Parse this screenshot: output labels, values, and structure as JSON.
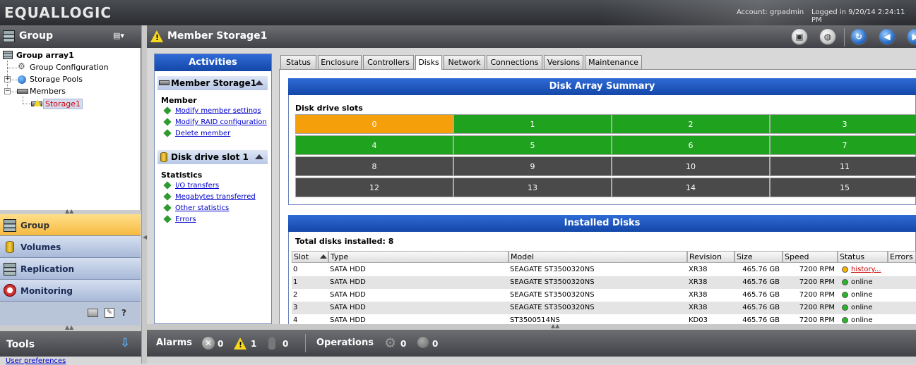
{
  "brand": "EQUALLOGIC",
  "header": {
    "account": "Account: grpadmin",
    "logged_in": "Logged in 9/20/14 2:24:11 PM"
  },
  "left_panel": {
    "title": "Group",
    "tree": [
      {
        "label": "Group array1"
      },
      {
        "label": "Group Configuration"
      },
      {
        "label": "Storage Pools"
      },
      {
        "label": "Members"
      },
      {
        "label": "Storage1"
      }
    ]
  },
  "nav": [
    {
      "label": "Group",
      "icon": "server-icon"
    },
    {
      "label": "Volumes",
      "icon": "cylinder-icon"
    },
    {
      "label": "Replication",
      "icon": "replication-icon"
    },
    {
      "label": "Monitoring",
      "icon": "gauge-icon"
    }
  ],
  "tools": {
    "title": "Tools",
    "link": "User preferences"
  },
  "main": {
    "title": "Member Storage1"
  },
  "activities": {
    "title": "Activities",
    "section1": {
      "title": "Member Storage1",
      "subtitle": "Member",
      "links": [
        "Modify member settings",
        "Modify RAID configuration",
        "Delete member"
      ]
    },
    "section2": {
      "title": "Disk drive slot 1",
      "subtitle": "Statistics",
      "links": [
        "I/O transfers",
        "Megabytes transferred",
        "Other statistics",
        "Errors"
      ]
    }
  },
  "tabs": [
    "Status",
    "Enclosure",
    "Controllers",
    "Disks",
    "Network",
    "Connections",
    "Versions",
    "Maintenance"
  ],
  "active_tab": "Disks",
  "summary": {
    "title": "Disk Array Summary",
    "slots_label": "Disk drive slots",
    "slots": [
      {
        "n": "0",
        "state": "warning"
      },
      {
        "n": "1",
        "state": "online"
      },
      {
        "n": "2",
        "state": "online"
      },
      {
        "n": "3",
        "state": "online"
      },
      {
        "n": "4",
        "state": "online"
      },
      {
        "n": "5",
        "state": "online"
      },
      {
        "n": "6",
        "state": "online"
      },
      {
        "n": "7",
        "state": "online"
      },
      {
        "n": "8",
        "state": "empty"
      },
      {
        "n": "9",
        "state": "empty"
      },
      {
        "n": "10",
        "state": "empty"
      },
      {
        "n": "11",
        "state": "empty"
      },
      {
        "n": "12",
        "state": "empty"
      },
      {
        "n": "13",
        "state": "empty"
      },
      {
        "n": "14",
        "state": "empty"
      },
      {
        "n": "15",
        "state": "empty"
      }
    ],
    "colors": {
      "warning": "#f5a00a",
      "online": "#1fa31f",
      "empty": "#4a4a4a"
    }
  },
  "installed": {
    "title": "Installed Disks",
    "total": "Total disks installed: 8",
    "columns": [
      "Slot",
      "Type",
      "Model",
      "Revision",
      "Size",
      "Speed",
      "Status",
      "Errors"
    ],
    "rows": [
      {
        "slot": "0",
        "type": "SATA HDD",
        "model": "SEAGATE ST3500320NS",
        "revision": "XR38",
        "size": "465.76 GB",
        "speed": "7200 RPM",
        "status": "history...",
        "state": "warning"
      },
      {
        "slot": "1",
        "type": "SATA HDD",
        "model": "SEAGATE ST3500320NS",
        "revision": "XR38",
        "size": "465.76 GB",
        "speed": "7200 RPM",
        "status": "online",
        "state": "online"
      },
      {
        "slot": "2",
        "type": "SATA HDD",
        "model": "SEAGATE ST3500320NS",
        "revision": "XR38",
        "size": "465.76 GB",
        "speed": "7200 RPM",
        "status": "online",
        "state": "online"
      },
      {
        "slot": "3",
        "type": "SATA HDD",
        "model": "SEAGATE ST3500320NS",
        "revision": "XR38",
        "size": "465.76 GB",
        "speed": "7200 RPM",
        "status": "online",
        "state": "online"
      },
      {
        "slot": "4",
        "type": "SATA HDD",
        "model": "ST3500514NS",
        "revision": "KD03",
        "size": "465.76 GB",
        "speed": "7200 RPM",
        "status": "online",
        "state": "online"
      }
    ]
  },
  "bottom": {
    "alarms_label": "Alarms",
    "alarm_critical": "0",
    "alarm_warning": "1",
    "alarm_info": "0",
    "operations_label": "Operations",
    "ops_active": "0",
    "ops_failed": "0"
  }
}
